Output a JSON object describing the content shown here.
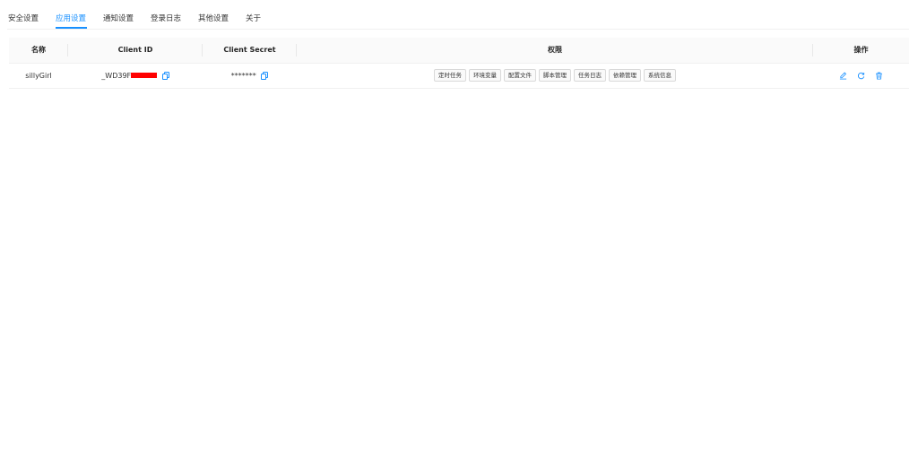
{
  "tabs": [
    {
      "label": "安全设置",
      "active": false
    },
    {
      "label": "应用设置",
      "active": true
    },
    {
      "label": "通知设置",
      "active": false
    },
    {
      "label": "登录日志",
      "active": false
    },
    {
      "label": "其他设置",
      "active": false
    },
    {
      "label": "关于",
      "active": false
    }
  ],
  "table": {
    "columns": [
      "名称",
      "Client ID",
      "Client Secret",
      "权限",
      "操作"
    ],
    "rows": [
      {
        "name": "sillyGirl",
        "client_id": "_WD39F",
        "client_secret": "*******",
        "permissions": [
          "定时任务",
          "环境变量",
          "配置文件",
          "脚本管理",
          "任务日志",
          "依赖管理",
          "系统信息"
        ],
        "actions": [
          "edit-icon",
          "reset-icon",
          "delete-icon"
        ]
      }
    ]
  },
  "colors": {
    "accent": "#1890ff",
    "redaction": "#ff0000"
  }
}
